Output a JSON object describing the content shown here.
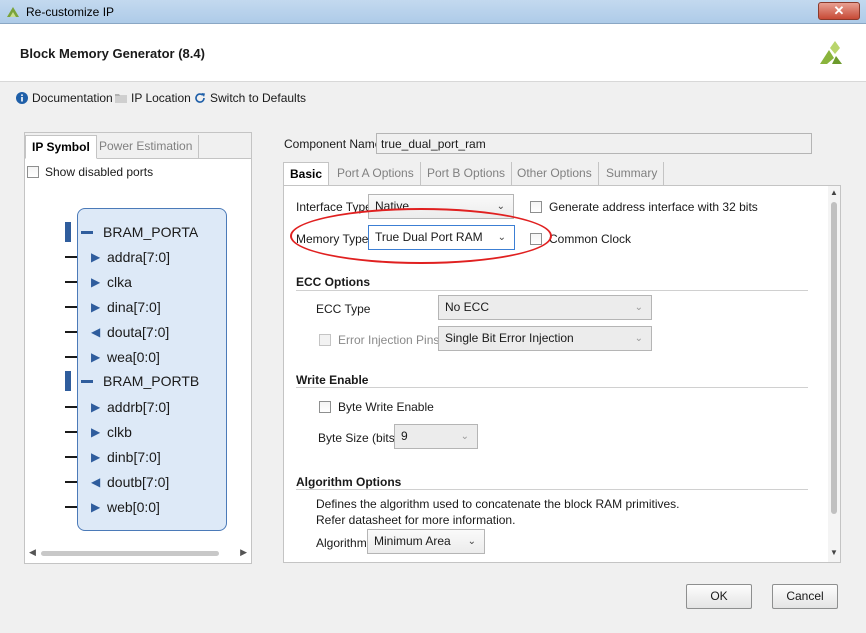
{
  "window": {
    "title": "Re-customize IP",
    "close_label": "✕"
  },
  "header": {
    "title": "Block Memory Generator (8.4)"
  },
  "toolbar": {
    "documentation": "Documentation",
    "ip_location": "IP Location",
    "switch_defaults": "Switch to Defaults"
  },
  "left_panel": {
    "tabs": [
      "IP Symbol",
      "Power Estimation"
    ],
    "show_disabled_ports": "Show disabled ports",
    "porta_label": "BRAM_PORTA",
    "portb_label": "BRAM_PORTB",
    "porta_ports": [
      {
        "name": "addra[7:0]",
        "dir": "in"
      },
      {
        "name": "clka",
        "dir": "in"
      },
      {
        "name": "dina[7:0]",
        "dir": "in"
      },
      {
        "name": "douta[7:0]",
        "dir": "out"
      },
      {
        "name": "wea[0:0]",
        "dir": "in"
      }
    ],
    "portb_ports": [
      {
        "name": "addrb[7:0]",
        "dir": "in"
      },
      {
        "name": "clkb",
        "dir": "in"
      },
      {
        "name": "dinb[7:0]",
        "dir": "in"
      },
      {
        "name": "doutb[7:0]",
        "dir": "out"
      },
      {
        "name": "web[0:0]",
        "dir": "in"
      }
    ]
  },
  "component": {
    "label": "Component Name",
    "value": "true_dual_port_ram"
  },
  "tabs": [
    "Basic",
    "Port A Options",
    "Port B Options",
    "Other Options",
    "Summary"
  ],
  "basic": {
    "interface_type_label": "Interface Type",
    "interface_type_value": "Native",
    "gen_addr_label": "Generate address interface with 32 bits",
    "memory_type_label": "Memory Type",
    "memory_type_value": "True Dual Port RAM",
    "common_clock_label": "Common Clock",
    "ecc_section": "ECC Options",
    "ecc_type_label": "ECC Type",
    "ecc_type_value": "No ECC",
    "error_injection_label": "Error Injection Pins",
    "error_injection_value": "Single Bit Error Injection",
    "write_enable_section": "Write Enable",
    "byte_write_label": "Byte Write Enable",
    "byte_size_label": "Byte Size (bits)",
    "byte_size_value": "9",
    "algorithm_section": "Algorithm Options",
    "algorithm_desc1": "Defines the algorithm used to concatenate the block RAM primitives.",
    "algorithm_desc2": "Refer datasheet for more information.",
    "algorithm_label": "Algorithm",
    "algorithm_value": "Minimum Area"
  },
  "buttons": {
    "ok": "OK",
    "cancel": "Cancel"
  },
  "colors": {
    "accent_blue": "#2f5d9d",
    "highlight_red": "#e02020",
    "logo_green": "#8ab43c"
  }
}
